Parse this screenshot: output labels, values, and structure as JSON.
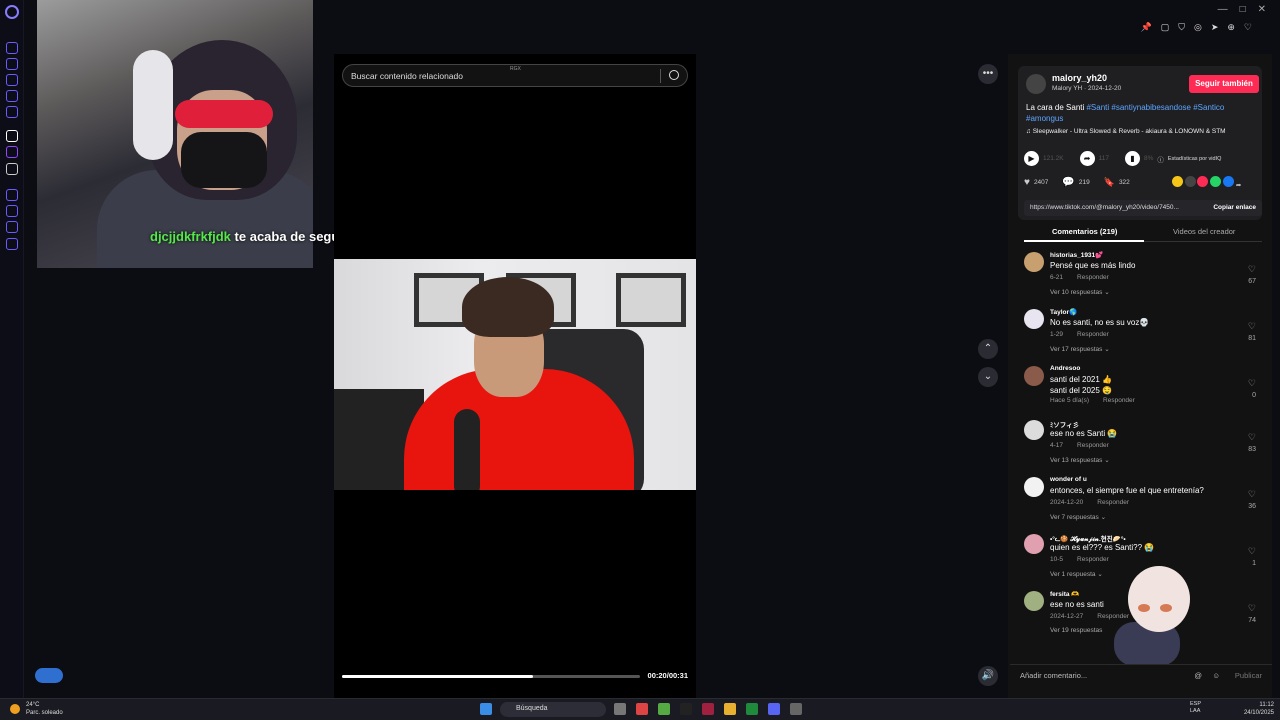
{
  "overlay": {
    "follow_user": "djcjjdkfrkfjdk",
    "follow_text": "te acaba de seguir!"
  },
  "search": {
    "placeholder": "Buscar contenido relacionado",
    "badge": "RGX"
  },
  "video": {
    "time": "00:20/00:31",
    "progress": 0.64
  },
  "post": {
    "username": "malory_yh20",
    "subline": "Malory YH · 2024-12-20",
    "follow_button": "Seguir también",
    "description": "La cara de Santi ",
    "hashtags": "#Santi #santiynabibesandose #Santico #amongus",
    "music": "Sleepwalker - Ultra Slowed & Reverb - akiaura & LONOWN & STM",
    "plays": "121.2K",
    "shares_top": "117",
    "percent": "8%",
    "stats_label": "Estadísticas por vidIQ",
    "likes": "2407",
    "comments": "219",
    "saves": "322",
    "link": "https://www.tiktok.com/@malory_yh20/video/7450...",
    "copy_link": "Copiar enlace"
  },
  "tabs": {
    "comments": "Comentarios (219)",
    "creator_videos": "Videos del creador"
  },
  "comments": [
    {
      "user": "historias_1931💕",
      "text": "Pensé que es más lindo",
      "date": "6-21",
      "reply": "Responder",
      "more": "Ver 10 respuestas ⌄",
      "likes": "67",
      "color": "#c8a070"
    },
    {
      "user": "Taylor🌎",
      "text": "No es santi, no es su voz💀",
      "date": "1-29",
      "reply": "Responder",
      "more": "Ver 17 respuestas ⌄",
      "likes": "81",
      "color": "#e8e4f0"
    },
    {
      "user": "Andresoo",
      "text": "santi del 2021 👍\nsanti del 2025 🤤",
      "date": "Hace 5 día(s)",
      "reply": "Responder",
      "more": "",
      "likes": "0",
      "color": "#8a5a4a"
    },
    {
      "user": "ﾐソフィ彡",
      "text": "ese no es Santi 😭",
      "date": "4-17",
      "reply": "Responder",
      "more": "Ver 13 respuestas ⌄",
      "likes": "83",
      "color": "#dcdcdc"
    },
    {
      "user": "wonder of u",
      "text": "entonces, el siempre fue el que entretenía?",
      "date": "2024-12-20",
      "reply": "Responder",
      "more": "Ver 7 respuestas ⌄",
      "likes": "36",
      "color": "#f2f2f2"
    },
    {
      "user": "•°ᓚ🍪 𝓗𝔂𝓾𝓷𝓳𝓲𝓷.현진🥟°•",
      "text": "quien es el??? es Santi?? 😭",
      "date": "10-5",
      "reply": "Responder",
      "more": "Ver 1 respuesta ⌄",
      "likes": "1",
      "color": "#e0a0b0"
    },
    {
      "user": "fersita 🫶",
      "text": "ese no es santi",
      "date": "2024-12-27",
      "reply": "Responder",
      "more": "Ver 19 respuestas",
      "likes": "74",
      "color": "#a0b080"
    }
  ],
  "comment_box": {
    "placeholder": "Añadir comentario...",
    "publish": "Publicar"
  },
  "taskbar": {
    "temp": "24°C",
    "weather": "Parc. soleado",
    "search": "Búsqueda",
    "lang1": "ESP",
    "lang2": "LAA",
    "time": "11:12",
    "date": "24/10/2025"
  }
}
